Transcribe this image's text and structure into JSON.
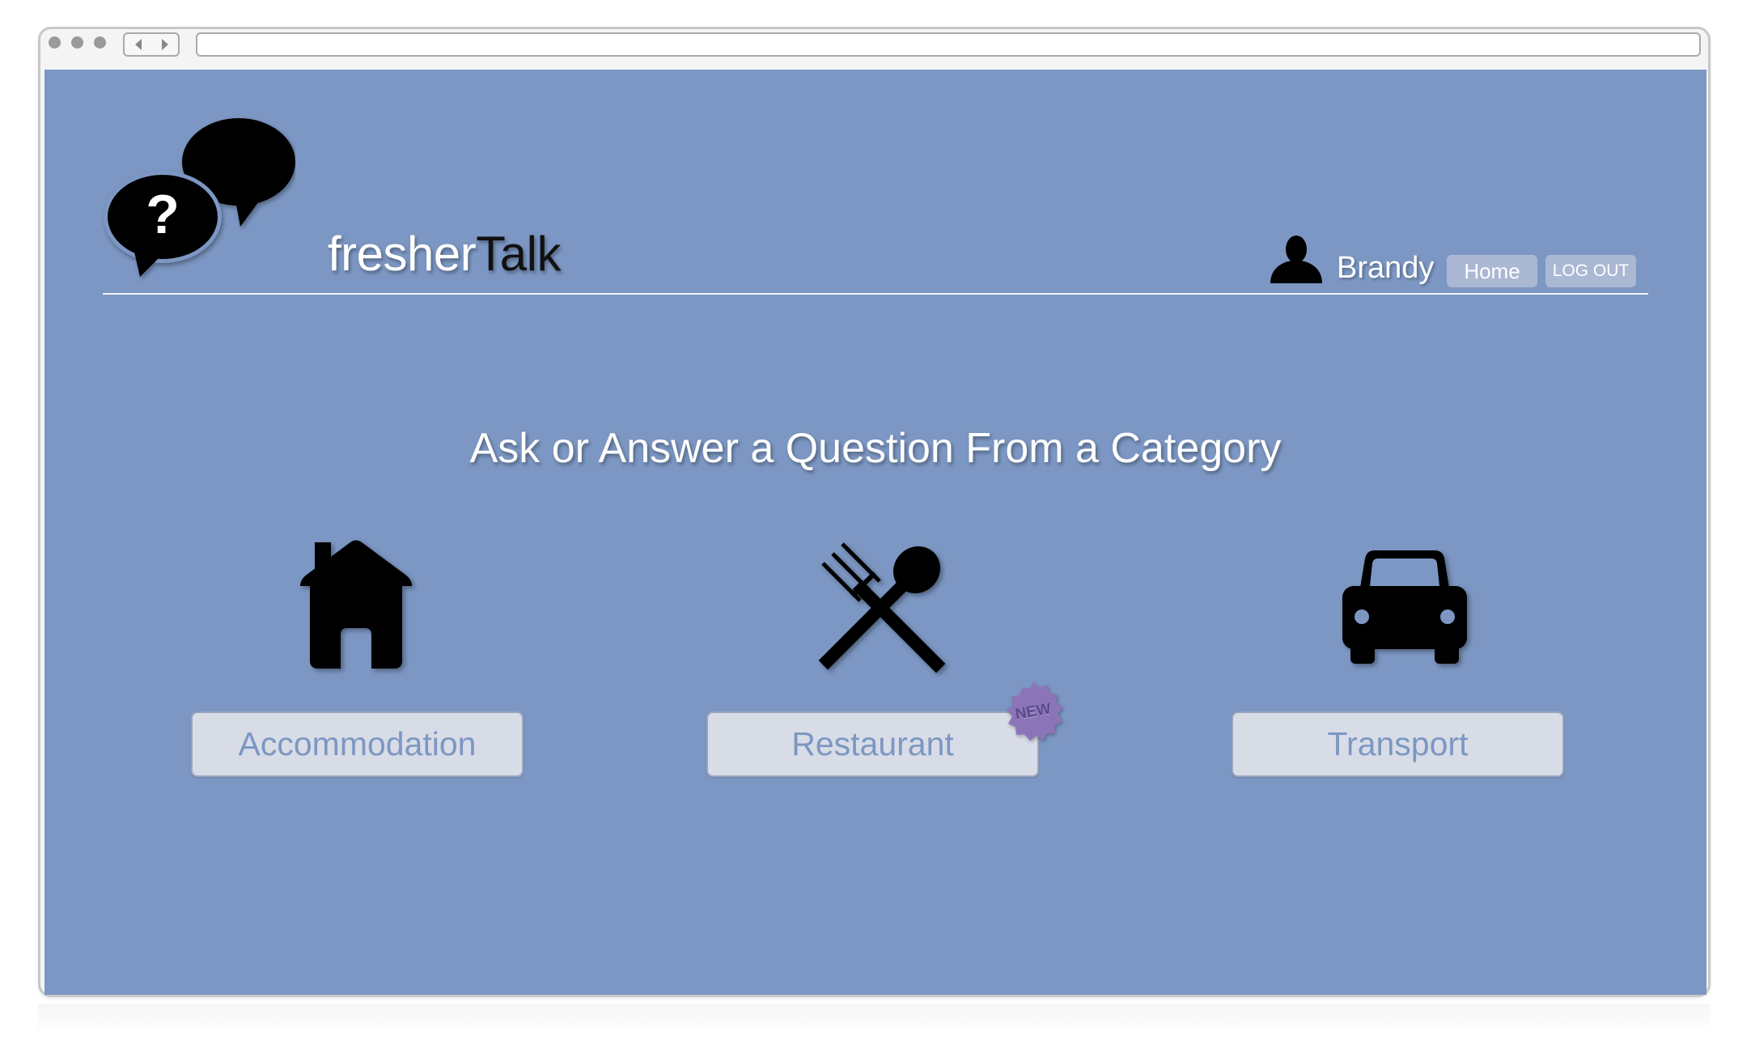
{
  "browser": {
    "back_icon": "chevron-left-icon",
    "forward_icon": "chevron-right-icon"
  },
  "header": {
    "logo_icon": "speech-bubbles-question-icon",
    "brand_part1": "fresher",
    "brand_part2": "Talk",
    "user_icon": "user-silhouette-icon",
    "user_name": "Brandy",
    "home_label": "Home",
    "logout_label": "LOG OUT"
  },
  "main": {
    "heading": "Ask or Answer a Question From a Category",
    "categories": [
      {
        "label": "Accommodation",
        "icon": "house-icon"
      },
      {
        "label": "Restaurant",
        "icon": "fork-spoon-icon",
        "badge": "NEW"
      },
      {
        "label": "Transport",
        "icon": "car-icon"
      }
    ]
  },
  "colors": {
    "page_background": "#7c97c3",
    "button_background": "#d8dce6",
    "button_text": "#7c97c3",
    "pill_background": "#aab8d3",
    "badge_color": "#8b74b8"
  }
}
